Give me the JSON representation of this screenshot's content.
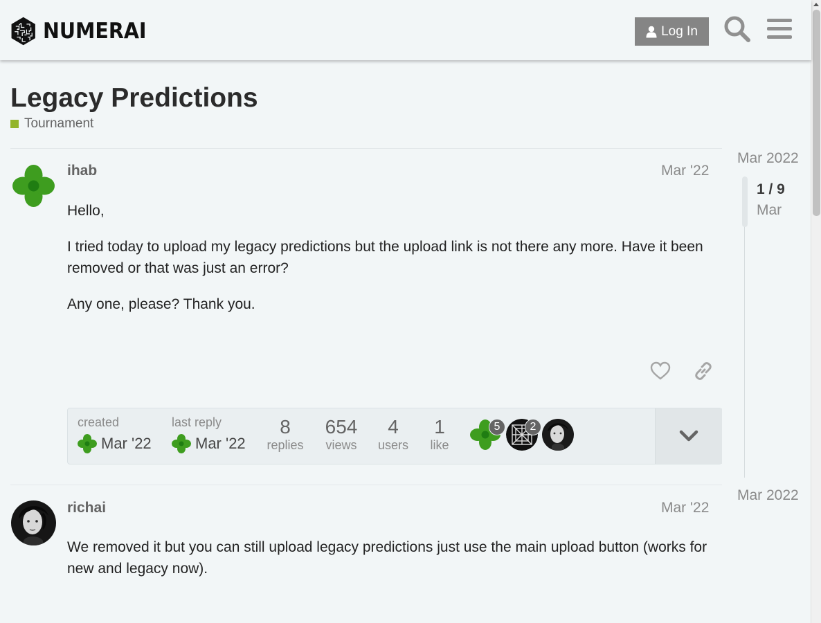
{
  "header": {
    "logo_text": "NUMERAI",
    "login_label": "Log In",
    "search_icon": "search-icon",
    "menu_icon": "hamburger-menu-icon"
  },
  "topic": {
    "title": "Legacy Predictions",
    "category": "Tournament",
    "category_color": "#93b52c"
  },
  "posts": [
    {
      "username": "ihab",
      "date": "Mar '22",
      "paragraphs": [
        "Hello,",
        "I tried today to upload my legacy predictions but the upload link is not there any more. Have it been removed or that was just an error?",
        "Any one, please? Thank you."
      ]
    },
    {
      "username": "richai",
      "date": "Mar '22",
      "paragraphs": [
        "We removed it but you can still upload legacy predictions just use the main upload button (works for new and legacy now)."
      ]
    }
  ],
  "topic_map": {
    "created_label": "created",
    "created_date": "Mar '22",
    "last_reply_label": "last reply",
    "last_reply_date": "Mar '22",
    "replies_count": "8",
    "replies_label": "replies",
    "views_count": "654",
    "views_label": "views",
    "users_count": "4",
    "users_label": "users",
    "likes_count": "1",
    "likes_label": "like",
    "participants": [
      {
        "badge": "5"
      },
      {
        "badge": "2"
      },
      {
        "badge": ""
      }
    ]
  },
  "timeline": {
    "top_date": "Mar 2022",
    "position": "1 / 9",
    "position_sub": "Mar",
    "bottom_date": "Mar 2022"
  }
}
